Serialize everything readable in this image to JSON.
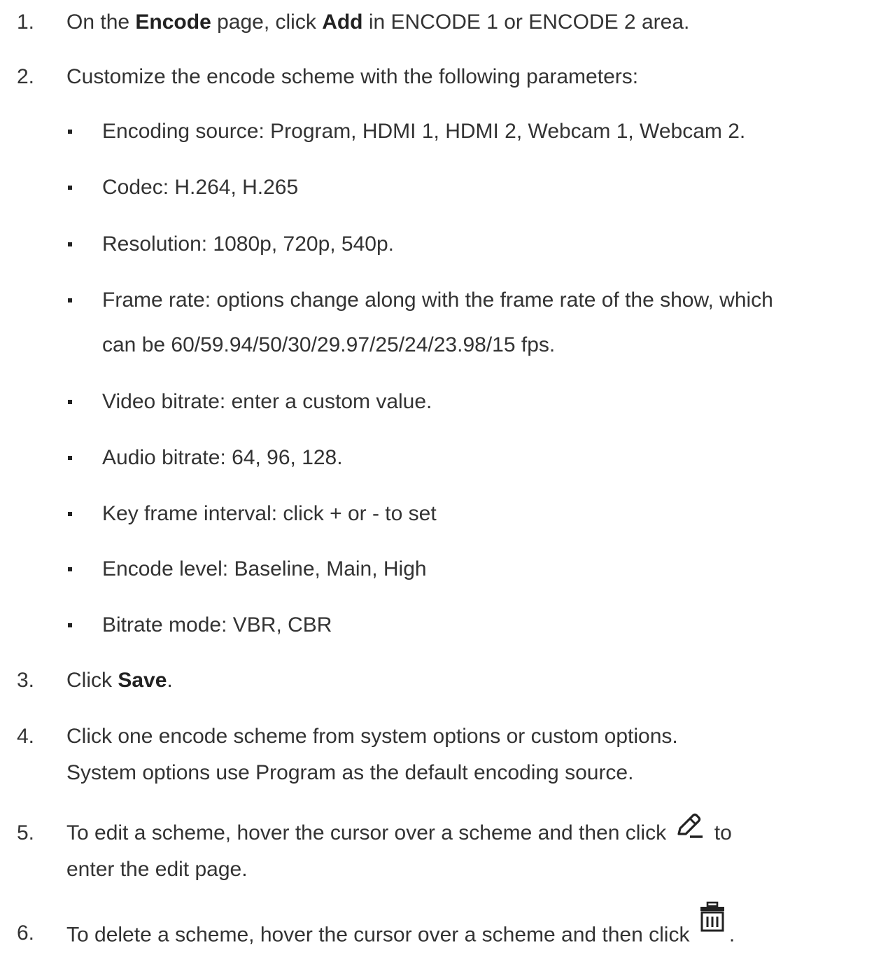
{
  "steps": [
    {
      "num": "1.",
      "pre1": "On the ",
      "bold1": "Encode",
      "pre2": " page, click ",
      "bold2": "Add",
      "post": " in ENCODE 1 or ENCODE 2 area."
    },
    {
      "num": "2.",
      "text": "Customize the encode scheme with the following parameters:",
      "bullets": [
        "Encoding source: Program, HDMI 1, HDMI 2, Webcam 1, Webcam 2.",
        "Codec: H.264, H.265",
        "Resolution: 1080p, 720p, 540p.",
        "Frame rate: options change along with the frame rate of the show, which",
        "can be 60/59.94/50/30/29.97/25/24/23.98/15 fps.",
        "Video bitrate: enter a custom value.",
        "Audio bitrate: 64, 96, 128.",
        "Key frame interval: click + or - to set",
        "Encode level: Baseline, Main, High",
        "Bitrate mode: VBR, CBR"
      ]
    },
    {
      "num": "3.",
      "pre": "Click ",
      "bold": "Save",
      "post": "."
    },
    {
      "num": "4.",
      "line1": "Click one encode scheme from system options or custom options.",
      "line2": "System options use Program as the default encoding source."
    },
    {
      "num": "5.",
      "line1_pre": "To edit a scheme, hover the cursor over a scheme and then click ",
      "line1_icon": "edit-pencil-icon",
      "line1_post": " to",
      "line2": "enter the edit page."
    },
    {
      "num": "6.",
      "line1_pre": "To delete a scheme, hover the cursor over a scheme and then click ",
      "line1_icon": "trash-icon",
      "line1_post": "."
    }
  ]
}
